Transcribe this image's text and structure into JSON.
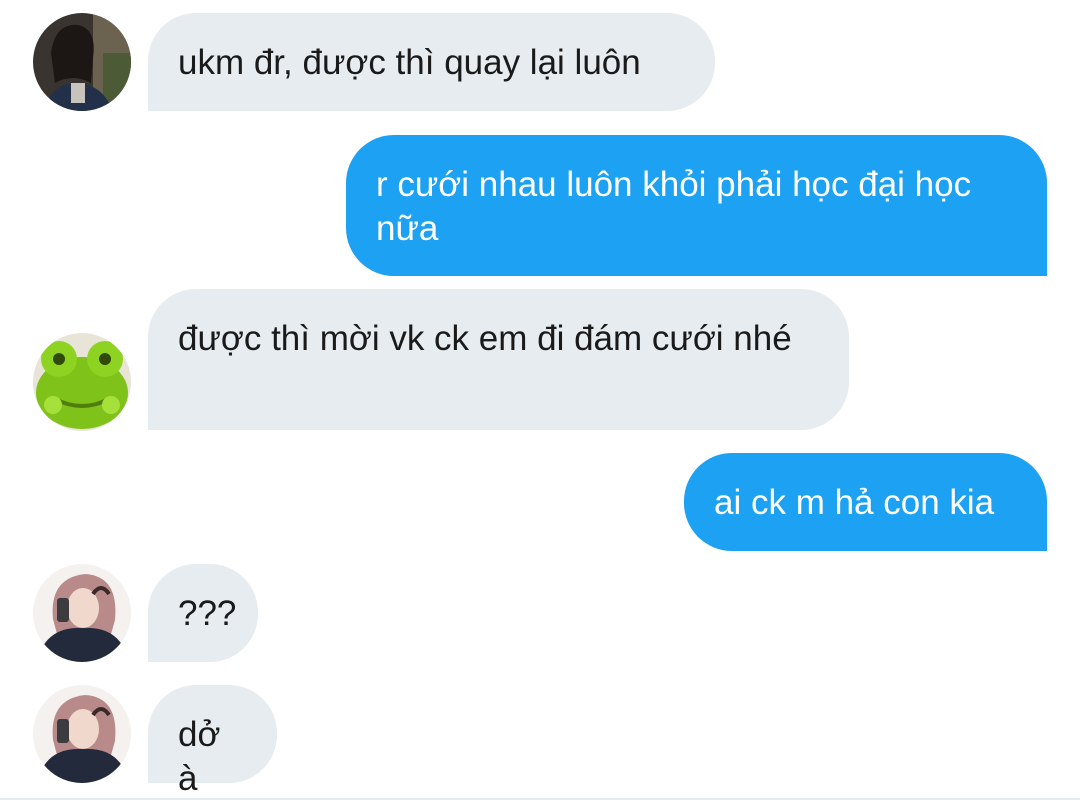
{
  "colors": {
    "incoming_bubble": "#e6ecf0",
    "outgoing_bubble": "#1da1f2",
    "incoming_text": "#1a1a1a",
    "outgoing_text": "#ffffff"
  },
  "messages": [
    {
      "direction": "incoming",
      "avatar": "avatar-girl-dark-photo",
      "text": "ukm đr, được thì quay lại luôn"
    },
    {
      "direction": "outgoing",
      "text": "r cưới nhau luôn khỏi phải học đại học nữa"
    },
    {
      "direction": "incoming",
      "avatar": "avatar-green-frog-plush",
      "text": "được thì mời vk ck em đi đám cưới nhé"
    },
    {
      "direction": "outgoing",
      "text": "ai ck m hả con kia"
    },
    {
      "direction": "incoming",
      "avatar": "avatar-girl-mirror-selfie",
      "text": "???"
    },
    {
      "direction": "incoming",
      "avatar": "avatar-girl-mirror-selfie",
      "text": "dở à"
    }
  ]
}
